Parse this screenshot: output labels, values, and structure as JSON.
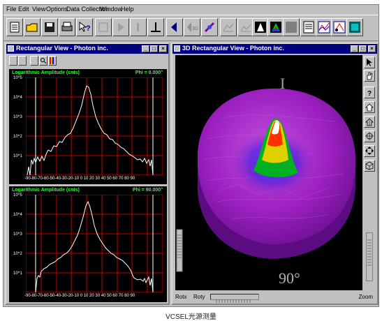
{
  "menu": [
    "File",
    "Edit",
    "View",
    "Options",
    "Data Collection",
    "Window",
    "Help"
  ],
  "toolbar_icons": [
    "new-icon",
    "open-icon",
    "save-icon",
    "print-icon",
    "help-pointer-icon",
    "disabled-icon",
    "play-icon",
    "pause-icon",
    "perpendicular-icon",
    "back-arrow-icon",
    "3d-icon",
    "satellite-icon",
    "surface-icon",
    "surface-alt-icon",
    "profile-icon",
    "rainbow-icon",
    "gray-block-icon",
    "report-icon",
    "chart-icon",
    "measure-icon",
    "export-icon"
  ],
  "left_window": {
    "title": "Rectangular View - Photon inc.",
    "plots": [
      {
        "ylabel": "Logarithmic Amplitude (cnts)",
        "phi": "Phi = 0.000°",
        "y_ticks": [
          "10^5",
          "10^4",
          "10^3",
          "10^2",
          "10^1"
        ]
      },
      {
        "ylabel": "Logarithmic Amplitude (cnts)",
        "phi": "Phi = 90.000°",
        "y_ticks": [
          "10^5",
          "10^4",
          "10^3",
          "10^2",
          "10^1"
        ]
      }
    ],
    "x_ticks": "-90-80-70-60-50-40-30-20-10 0 10 20 30 40 50 60 70 80 90"
  },
  "right_window": {
    "title": "3D Rectangular View - Photon inc.",
    "angle_top": "I",
    "angle_bottom": "90°",
    "bottom_labels": {
      "rotx": "Rotx",
      "roty": "Roty",
      "zoom": "Zoom"
    }
  },
  "caption": "VCSEL光源测量",
  "colors": {
    "title_bar": "#000080",
    "plot_bg": "#000000",
    "grid": "#cc0000",
    "label": "#33ff33",
    "surface": "#a020c0"
  }
}
